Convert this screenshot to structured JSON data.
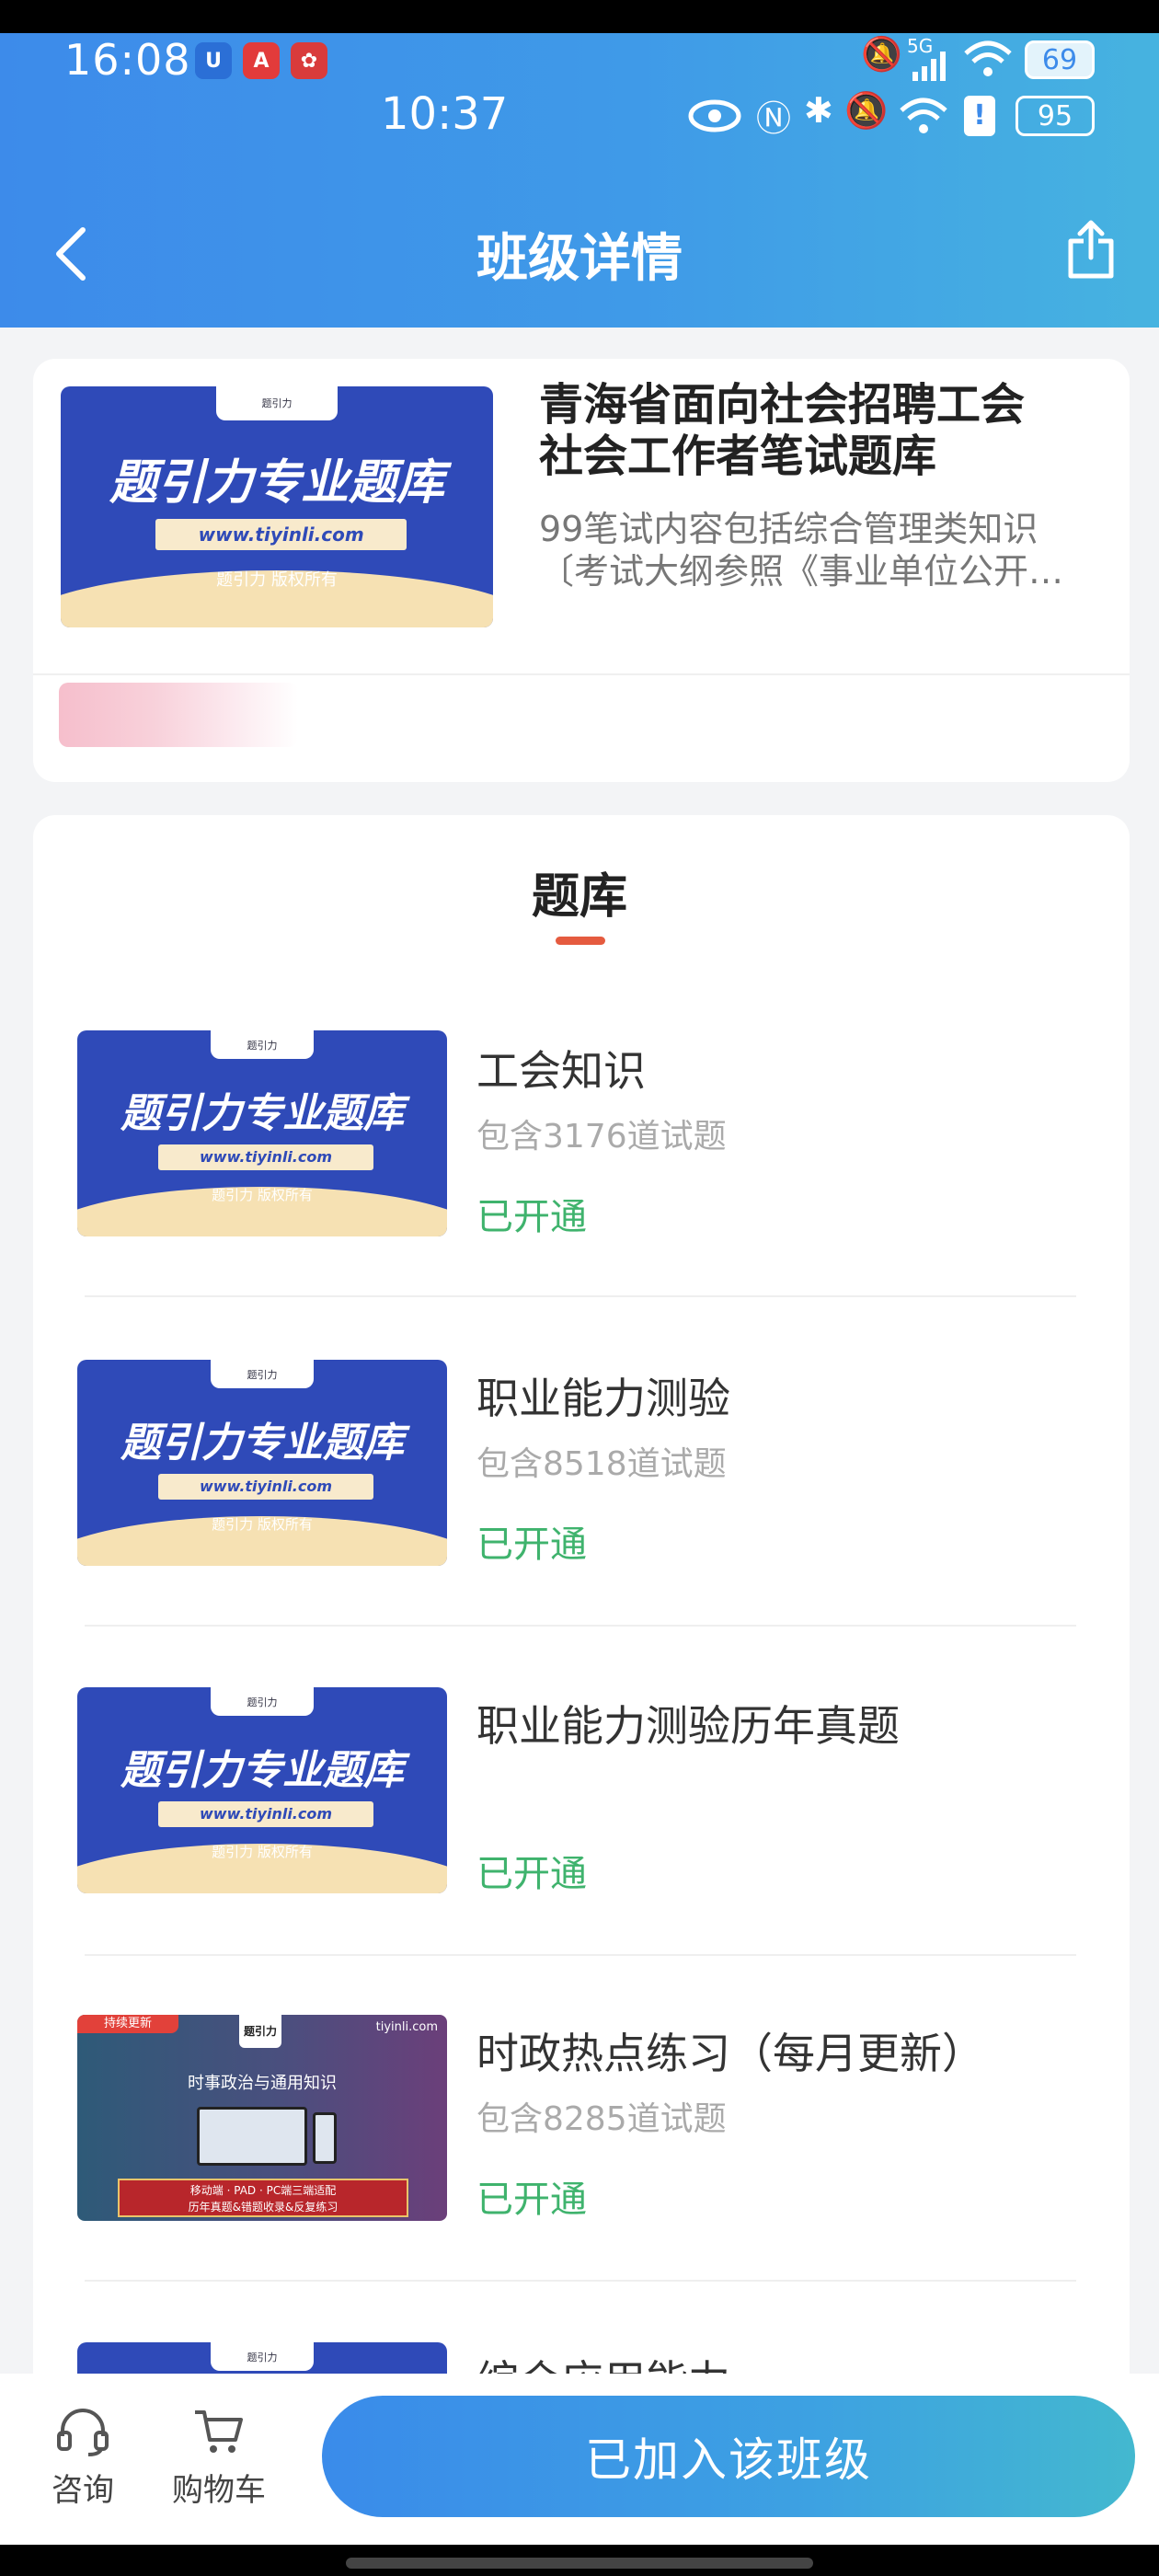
{
  "status_bar": {
    "time_outer": "16:08",
    "time_inner": "10:37",
    "network": "5G",
    "battery_outer": "69",
    "battery_inner": "95"
  },
  "header": {
    "title": "班级详情"
  },
  "course": {
    "title_line1": "青海省面向社会招聘工会",
    "title_line2": "社会工作者笔试题库",
    "desc_line1": "99笔试内容包括综合管理类知识",
    "desc_line2": "〔考试大纲参照《事业单位公开…"
  },
  "thumb": {
    "brand": "题引力",
    "headline": "题引力专业题库",
    "url": "www.tiyinli.com",
    "copyright": "题引力 版权所有"
  },
  "news_thumb": {
    "badge": "持续更新",
    "logo": "题引力",
    "site": "tiyinli.com",
    "headline": "时事政治与通用知识",
    "banner_line1": "移动端 · PAD · PC端三端适配",
    "banner_line2": "历年真题&错题收录&反复练习"
  },
  "section": {
    "title": "题库"
  },
  "items": [
    {
      "name": "工会知识",
      "count": "包含3176道试题",
      "status": "已开通"
    },
    {
      "name": "职业能力测验",
      "count": "包含8518道试题",
      "status": "已开通"
    },
    {
      "name": "职业能力测验历年真题",
      "count": "",
      "status": "已开通"
    },
    {
      "name": "时政热点练习（每月更新）",
      "count": "包含8285道试题",
      "status": "已开通"
    },
    {
      "name": "综合应用能力"
    }
  ],
  "bottom_bar": {
    "consult_label": "咨询",
    "cart_label": "购物车",
    "join_label": "已加入该班级"
  },
  "colors": {
    "header_gradient_start": "#3d8bea",
    "header_gradient_end": "#46b3e0",
    "status_green": "#3fb36d",
    "accent_red": "#e55b3f",
    "thumb_blue": "#2f4ab8"
  }
}
